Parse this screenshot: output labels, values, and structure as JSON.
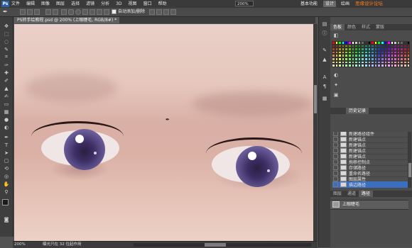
{
  "menubar": {
    "logo": "Ps",
    "items": [
      "文件",
      "编辑",
      "图像",
      "图层",
      "选择",
      "滤镜",
      "分析",
      "3D",
      "视图",
      "窗口",
      "帮助"
    ],
    "zoom": "200%",
    "workspaces": [
      "基本功能",
      "设计",
      "绘画"
    ],
    "watermark": "思缘设计论坛 www.MISSYUAN.COM"
  },
  "options": {
    "auto_add_delete_label": "自动添加/删除"
  },
  "document": {
    "tab_title": "PS转手绘教程.psd @ 200% (上眼睫毛, RGB/8#) *"
  },
  "status": {
    "zoom": "200%",
    "info": "曝光只在 32 位起作用"
  },
  "panels": {
    "color_tabs": [
      "色板",
      "颜色",
      "样式",
      "蒙版"
    ],
    "history_tabs": [
      "历史记录"
    ],
    "layers_tabs": [
      "图层",
      "通道",
      "路径"
    ],
    "history_items": [
      "新建路径组件",
      "新建锚点",
      "新建锚点",
      "新建锚点",
      "新建锚点",
      "拖移控制点",
      "存储路径",
      "重命名路径",
      "图层属性",
      "描边路径"
    ],
    "path_name": "上眼睫毛"
  },
  "colors": {
    "accent": "#3a6fc0",
    "watermark": "#ff7a1a"
  }
}
